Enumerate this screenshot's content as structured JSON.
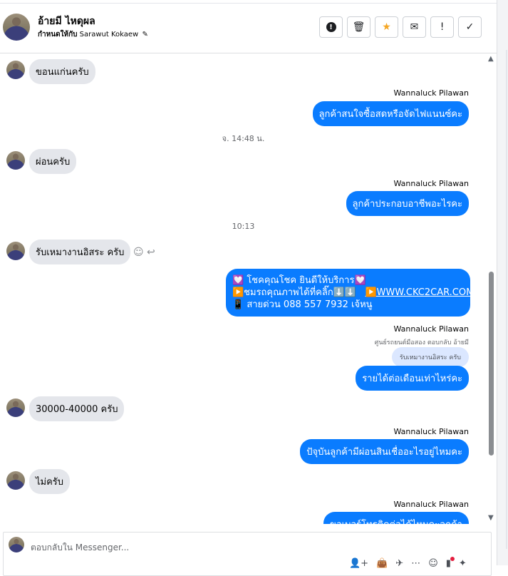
{
  "header": {
    "name": "อ้ายมี ไหดุผล",
    "assignee_label": "กำหนดให้กับ",
    "assignee_name": "Sarawut Kokaew",
    "pen_icon": "✎",
    "tools": [
      {
        "name": "report-button",
        "icon": "!",
        "kind": "alert-icon"
      },
      {
        "name": "delete-button",
        "icon": "🗑",
        "kind": "trash-icon"
      },
      {
        "name": "star-button",
        "icon": "★",
        "kind": "star-icon"
      },
      {
        "name": "mark-unread-button",
        "icon": "✉",
        "kind": "envelope-icon"
      },
      {
        "name": "follow-up-button",
        "icon": "!",
        "kind": "exclamation-icon"
      },
      {
        "name": "done-button",
        "icon": "✓",
        "kind": "check-icon"
      }
    ]
  },
  "messages": {
    "m1": "ขอนแก่นครับ",
    "sender1": "Wannaluck Pilawan",
    "m2": "ลูกค้าสนใจซื้อสดหรือจัดไฟแนนซ์คะ",
    "ts1": "จ. 14:48 น.",
    "m3": "ผ่อนครับ",
    "sender2": "Wannaluck Pilawan",
    "m4": "ลูกค้าประกอบอาชีพอะไรคะ",
    "ts2": "10:13",
    "m5": "รับเหมางานอิสระ  ครับ",
    "react_icons": "☺ ↩",
    "big_line1": "💟 โชคคุณโชค ยินดีให้บริการ💟",
    "big_line2_prefix": "▶️ชมรถคุณภาพได้ที่คลิ๊ก⬇️⬇️",
    "big_line2_link": "▶️WWW.CKC2CAR.COM",
    "big_line3": "📱 สายด่วน 088 557 7932 เจ้หนู",
    "sender3": "Wannaluck Pilawan",
    "reply_note": "ศูนย์รถยนต์มือสอง ตอบกลับ อ้ายมี",
    "quote": "รับเหมางานอิสระ ครับ",
    "m6": "รายได้ต่อเดือนเท่าไหร่คะ",
    "m7": "30000-40000  ครับ",
    "sender4": "Wannaluck Pilawan",
    "m8": "ปัจุบันลูกค้ามีผ่อนสินเชื่ออะไรอยู่ไหมคะ",
    "m9": "ไม่ครับ",
    "sender5": "Wannaluck Pilawan",
    "m10": "ขอเบอร์โทรติดต่อได้ไหมคะลูกค้า"
  },
  "scrollbar": {
    "up": "▲",
    "down": "▼"
  },
  "composer": {
    "placeholder": "ตอบกลับใน Messenger...",
    "icons": [
      "👤+",
      "👜",
      "✈",
      "⋯",
      "☺",
      "▮",
      "✦"
    ]
  },
  "colors": {
    "outgoing": "#0a7cff",
    "incoming": "#e4e6eb",
    "star": "#f5a623"
  }
}
